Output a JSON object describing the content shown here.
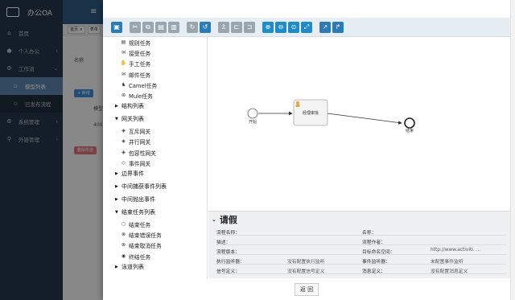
{
  "app": {
    "title": "办公OA",
    "nav": [
      {
        "label": "首页",
        "icon": "home-icon"
      },
      {
        "label": "个人办公",
        "icon": "user-icon",
        "expandable": true
      },
      {
        "label": "工作流",
        "icon": "workflow-icon",
        "expandable": true
      }
    ],
    "workflow_sub": [
      {
        "label": "模型列表",
        "active": true
      },
      {
        "label": "已发布流程",
        "active": false
      }
    ],
    "nav_bottom": [
      {
        "label": "系统管理",
        "icon": "gear-icon"
      },
      {
        "label": "外链管理",
        "icon": "link-icon"
      }
    ],
    "tabs": [
      "首页 ×",
      "表单"
    ],
    "bg_form_label": "名称",
    "bg_add_button": "+ 新增",
    "bg_row_label": "模型",
    "bg_row_value": "4005",
    "bg_delete_button": "删除所选"
  },
  "toolbar": {
    "buttons": [
      {
        "name": "save-button",
        "icon": "save-icon",
        "glyph": "▣",
        "style": "blue"
      },
      {
        "name": "cut-button",
        "icon": "cut-icon",
        "glyph": "✂",
        "style": "grey",
        "gap_before": true
      },
      {
        "name": "copy-button",
        "icon": "copy-icon",
        "glyph": "⧉",
        "style": "grey"
      },
      {
        "name": "paste-button",
        "icon": "paste-icon",
        "glyph": "▤",
        "style": "grey"
      },
      {
        "name": "delete-button",
        "icon": "trash-icon",
        "glyph": "▥",
        "style": "grey"
      },
      {
        "name": "redo-button",
        "icon": "redo-icon",
        "glyph": "↻",
        "style": "grey",
        "gap_before": true
      },
      {
        "name": "undo-button",
        "icon": "undo-icon",
        "glyph": "↺",
        "style": "blue"
      },
      {
        "name": "align-button",
        "icon": "align-icon",
        "glyph": "⇫",
        "style": "grey",
        "gap_before": true
      },
      {
        "name": "bend-point-add-button",
        "icon": "bend-add-icon",
        "glyph": "⊏",
        "style": "grey"
      },
      {
        "name": "bend-point-remove-button",
        "icon": "bend-remove-icon",
        "glyph": "⊐",
        "style": "grey"
      },
      {
        "name": "zoom-in-button",
        "icon": "zoom-in-icon",
        "glyph": "⊕",
        "style": "teal",
        "gap_before": true
      },
      {
        "name": "zoom-out-button",
        "icon": "zoom-out-icon",
        "glyph": "⊖",
        "style": "teal"
      },
      {
        "name": "zoom-actual-button",
        "icon": "zoom-actual-icon",
        "glyph": "⊙",
        "style": "teal"
      },
      {
        "name": "zoom-fit-button",
        "icon": "zoom-fit-icon",
        "glyph": "⤢",
        "style": "teal"
      },
      {
        "name": "connector-button",
        "icon": "connector-icon",
        "glyph": "↗",
        "style": "blue",
        "gap_before": true
      },
      {
        "name": "connector-bend-button",
        "icon": "connector-bend-icon",
        "glyph": "↱",
        "style": "blue"
      }
    ]
  },
  "palette": {
    "items": [
      {
        "type": "item",
        "label": "规则任务",
        "icon": "rule-task-icon",
        "glyph": "▤"
      },
      {
        "type": "item",
        "label": "接受任务",
        "icon": "receive-task-icon",
        "glyph": "✉"
      },
      {
        "type": "item",
        "label": "手工任务",
        "icon": "manual-task-icon",
        "glyph": "✋"
      },
      {
        "type": "item",
        "label": "邮件任务",
        "icon": "mail-task-icon",
        "glyph": "✉"
      },
      {
        "type": "item",
        "label": "Camel任务",
        "icon": "camel-task-icon",
        "glyph": "♞"
      },
      {
        "type": "item",
        "label": "Mule任务",
        "icon": "mule-task-icon",
        "glyph": "⊛"
      },
      {
        "type": "group",
        "label": "结构列表",
        "expanded": false
      },
      {
        "type": "group",
        "label": "网关列表",
        "expanded": true
      },
      {
        "type": "item",
        "label": "互斥网关",
        "icon": "exclusive-gateway-icon",
        "glyph": "◈"
      },
      {
        "type": "item",
        "label": "并行网关",
        "icon": "parallel-gateway-icon",
        "glyph": "◈"
      },
      {
        "type": "item",
        "label": "包容性网关",
        "icon": "inclusive-gateway-icon",
        "glyph": "◈"
      },
      {
        "type": "item",
        "label": "事件网关",
        "icon": "event-gateway-icon",
        "glyph": "◇"
      },
      {
        "type": "group",
        "label": "边界事件",
        "expanded": false
      },
      {
        "type": "group",
        "label": "中间捕获事件列表",
        "expanded": false
      },
      {
        "type": "group",
        "label": "中间抛出事件",
        "expanded": false
      },
      {
        "type": "group",
        "label": "结束任务列表",
        "expanded": true
      },
      {
        "type": "item",
        "label": "结束任务",
        "icon": "end-event-icon",
        "glyph": "○"
      },
      {
        "type": "item",
        "label": "结束错误任务",
        "icon": "end-error-icon",
        "glyph": "⊗"
      },
      {
        "type": "item",
        "label": "结束取消任务",
        "icon": "end-cancel-icon",
        "glyph": "⊗"
      },
      {
        "type": "item",
        "label": "终结任务",
        "icon": "terminate-icon",
        "glyph": "◉"
      },
      {
        "type": "group",
        "label": "泳道列表",
        "expanded": false
      }
    ]
  },
  "diagram": {
    "start_label": "开始",
    "task_label": "经理审批",
    "end_label": "结束"
  },
  "properties": {
    "title": "请假",
    "rows": [
      {
        "k1": "流程名称：",
        "v1": "",
        "k2": "名称：",
        "v2": ""
      },
      {
        "k1": "描述：",
        "v1": "",
        "k2": "流程作者：",
        "v2": ""
      },
      {
        "k1": "流程版本：",
        "v1": "",
        "k2": "目标命名空间：",
        "v2": "http://www.activiti. ..."
      },
      {
        "k1": "执行监听器：",
        "v1": "没有配置执行监听",
        "k2": "事件监听器：",
        "v2": "未配置事件监听"
      },
      {
        "k1": "信号定义：",
        "v1": "没有配置信号定义",
        "k2": "消息定义：",
        "v2": "没有配置消息定义"
      }
    ]
  },
  "footer": {
    "back_label": "返 回"
  }
}
